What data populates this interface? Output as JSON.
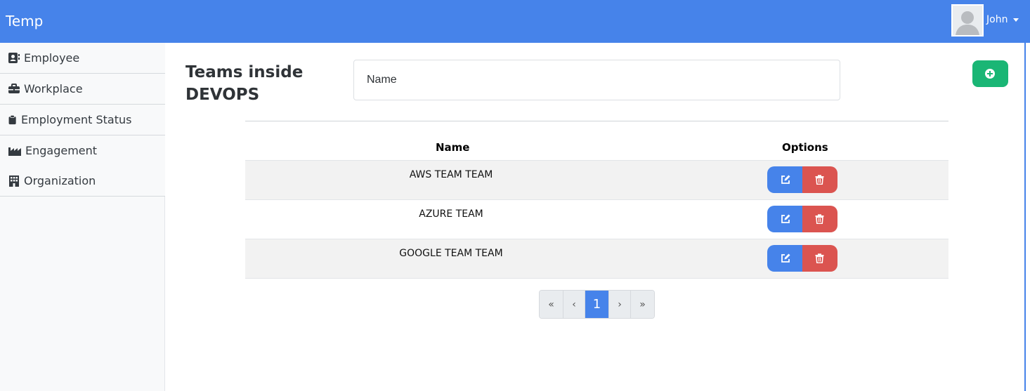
{
  "navbar": {
    "brand": "Temp",
    "user": "John"
  },
  "sidebar": {
    "items": [
      {
        "label": "Employee",
        "icon": "contact-card-icon"
      },
      {
        "label": "Workplace",
        "icon": "briefcase-icon"
      },
      {
        "label": "Employment Status",
        "icon": "clipboard-icon"
      },
      {
        "label": "Engagement",
        "icon": "industry-icon"
      },
      {
        "label": "Organization",
        "icon": "building-icon"
      }
    ]
  },
  "main": {
    "title": "Teams inside DEVOPS",
    "search_placeholder": "Name",
    "add_icon": "plus-circle-icon",
    "table": {
      "headers": {
        "name": "Name",
        "options": "Options"
      },
      "rows": [
        {
          "name": "AWS TEAM TEAM"
        },
        {
          "name": "AZURE TEAM"
        },
        {
          "name": "GOOGLE TEAM TEAM"
        }
      ]
    },
    "pagination": {
      "first": "«",
      "prev": "‹",
      "current": "1",
      "next": "›",
      "last": "»"
    }
  },
  "colors": {
    "navbar": "#4683ea",
    "edit": "#4683ea",
    "delete": "#db5450",
    "add": "#1ab675"
  }
}
